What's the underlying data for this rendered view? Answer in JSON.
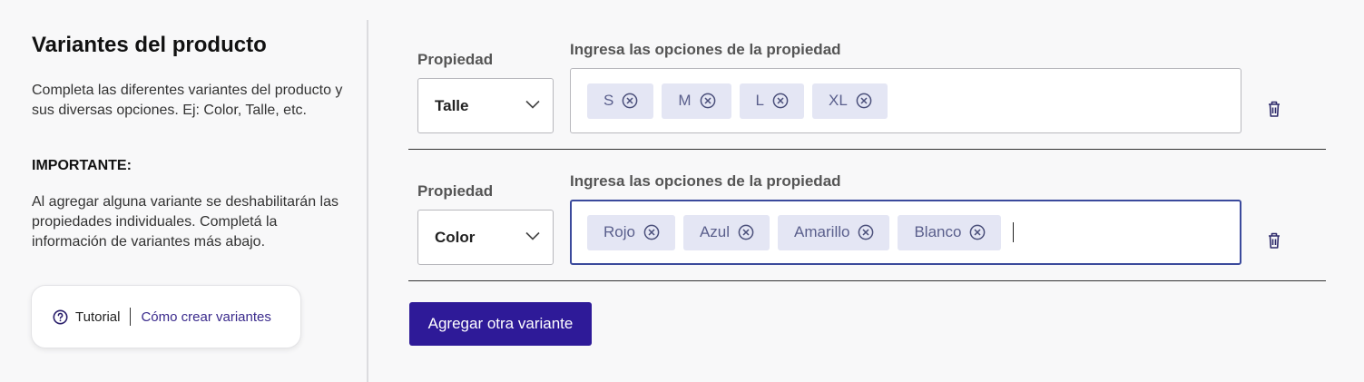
{
  "sidebar": {
    "title": "Variantes del producto",
    "description": "Completa las diferentes variantes del producto y sus diversas opciones. Ej: Color, Talle, etc.",
    "important_label": "IMPORTANTE:",
    "note": "Al agregar alguna variante se deshabilitarán las propiedades individuales. Completá la información de variantes más abajo.",
    "tutorial": {
      "icon": "help-circle-icon",
      "label": "Tutorial",
      "link": "Cómo crear variantes"
    }
  },
  "variants": [
    {
      "property_label": "Propiedad",
      "property_value": "Talle",
      "options_label": "Ingresa las opciones de la propiedad",
      "options": [
        "S",
        "M",
        "L",
        "XL"
      ],
      "focused": false
    },
    {
      "property_label": "Propiedad",
      "property_value": "Color",
      "options_label": "Ingresa las opciones de la propiedad",
      "options": [
        "Rojo",
        "Azul",
        "Amarillo",
        "Blanco"
      ],
      "focused": true
    }
  ],
  "actions": {
    "add_variant": "Agregar otra variante"
  },
  "colors": {
    "primary": "#2e1a98",
    "chip_bg": "#e4e6f4",
    "focus_border": "#3b4a9c"
  }
}
